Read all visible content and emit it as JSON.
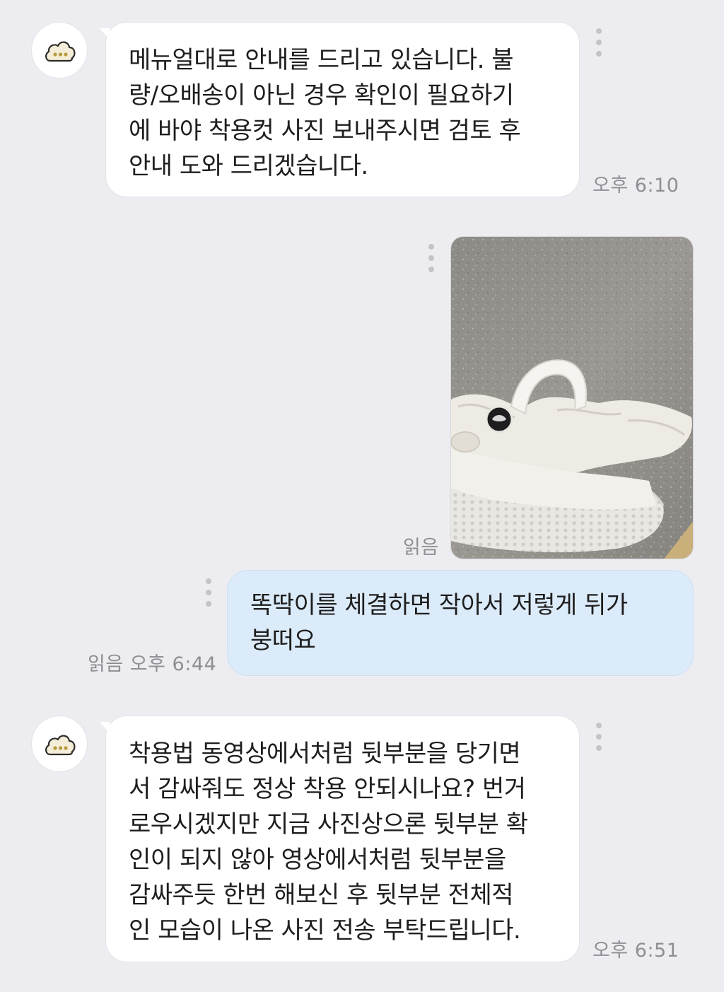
{
  "messages": [
    {
      "sender": "agent",
      "text": "메뉴얼대로 안내를 드리고 있습니다. 불\n량/오배송이 아닌 경우 확인이 필요하기\n에 바야 착용컷 사진 보내주시면 검토 후\n안내 도와 드리겠습니다.",
      "time": "오후 6:10"
    },
    {
      "sender": "me",
      "type": "photo",
      "image_desc": "white fleece-lined clog on stone floor",
      "read": "읽음"
    },
    {
      "sender": "me",
      "text": "똑딱이를 체결하면 작아서 저렇게 뒤가\n붕떠요",
      "read": "읽음",
      "time": "오후 6:44"
    },
    {
      "sender": "agent",
      "text": "착용법 동영상에서처럼 뒷부분을 당기면\n서 감싸줘도 정상 착용 안되시나요? 번거\n로우시겠지만 지금 사진상으론 뒷부분 확\n인이 되지 않아 영상에서처럼 뒷부분을\n감싸주듯 한번 해보신 후 뒷부분 전체적\n인 모습이 나온 사진 전송 부탁드립니다.",
      "time": "오후 6:51"
    }
  ],
  "colors": {
    "background": "#ededf1",
    "incoming_bubble": "#ffffff",
    "outgoing_bubble": "#dcebfa",
    "meta_text": "#8e8e93"
  },
  "icons": {
    "avatar": "cloud-dots-icon",
    "more": "more-vertical-icon"
  }
}
